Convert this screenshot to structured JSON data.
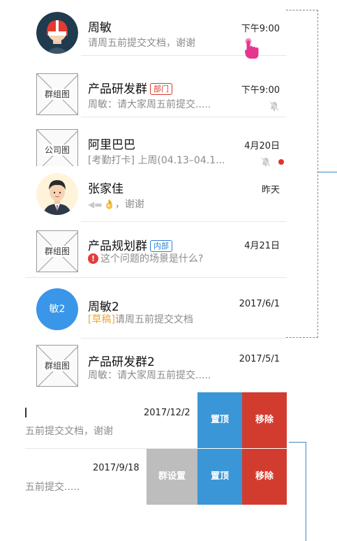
{
  "chats": [
    {
      "name": "周敏",
      "message": "请周五前提交文档，谢谢",
      "time": "下午9:00",
      "avatar_type": "photo-red-helmet"
    },
    {
      "name": "产品研发群",
      "tag": "部门",
      "tag_color": "#d53a2b",
      "message": "周敏：请大家周五前提交.....",
      "time": "下午9:00",
      "muted": true,
      "avatar_label": "群组图"
    },
    {
      "name": "阿里巴巴",
      "message": "[考勤打卡] 上周(04.13–04.1...",
      "time": "4月20日",
      "muted": true,
      "unread_dot": true,
      "avatar_label": "公司图"
    },
    {
      "name": "张家佳",
      "message": "，谢谢",
      "message_icons": [
        "back-arrow-icon",
        "ok-hand-icon"
      ],
      "time": "昨天",
      "avatar_type": "photo-man-suit"
    },
    {
      "name": "产品规划群",
      "tag": "内部",
      "tag_color": "#2d7fd8",
      "message": "这个问题的场景是什么?",
      "message_icon": "warning-icon",
      "time": "4月21日",
      "avatar_label": "群组图"
    },
    {
      "name": "周敏2",
      "draft_label": "[草稿]",
      "message": "请周五前提交文档",
      "time": "2017/6/1",
      "avatar_text": "敏2",
      "avatar_color": "#3a96e8"
    },
    {
      "name": "产品研发群2",
      "message": "周敏：请大家周五前提交.....",
      "time": "2017/5/1",
      "avatar_label": "群组图"
    }
  ],
  "swipe_rows": [
    {
      "message": "五前提交文档，谢谢",
      "time": "2017/12/2",
      "actions": [
        "置顶",
        "移除"
      ]
    },
    {
      "message": "五前提交.....",
      "time": "2017/9/18",
      "actions": [
        "群设置",
        "置顶",
        "移除"
      ]
    }
  ],
  "colors": {
    "pin": "#3a96d6",
    "remove": "#d23c2f",
    "group_settings": "#bdbdbd",
    "gesture": "#e6358f",
    "connector": "#3a8ac4"
  }
}
